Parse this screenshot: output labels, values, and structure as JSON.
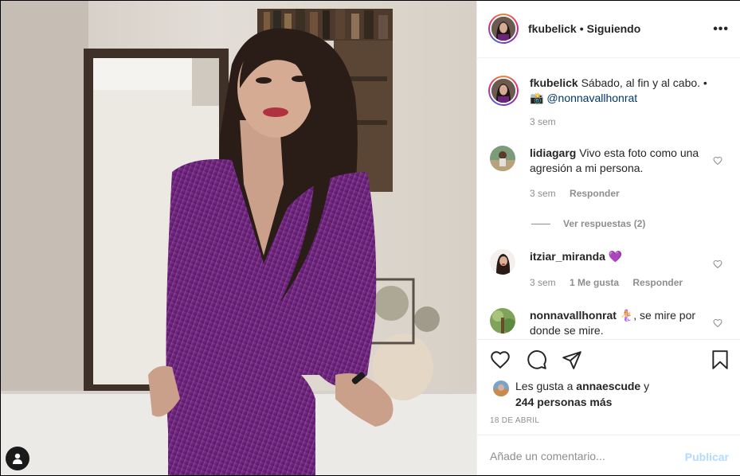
{
  "post": {
    "username": "fkubelick",
    "follow_status": "Siguiendo",
    "separator": "•",
    "more_icon": "more-horizontal-icon",
    "user_tag_icon": "person-tag-icon"
  },
  "caption": {
    "username": "fkubelick",
    "text": "Sábado, al fin y al cabo. •",
    "emoji": "📸",
    "mention": "@nonnavallhonrat",
    "time": "3 sem"
  },
  "comments": [
    {
      "username": "lidiagarg",
      "text": "Vivo esta foto como una agresión a mi persona.",
      "time": "3 sem",
      "reply_label": "Responder",
      "view_replies": "Ver respuestas (2)"
    },
    {
      "username": "itziar_miranda",
      "text": "💜",
      "time": "3 sem",
      "likes_label": "1 Me gusta",
      "reply_label": "Responder"
    },
    {
      "username": "nonnavallhonrat",
      "text": "🧜‍♀️, se mire por donde se mire."
    }
  ],
  "actions": {
    "like_icon": "heart-icon",
    "comment_icon": "comment-icon",
    "share_icon": "paper-plane-icon",
    "save_icon": "bookmark-icon"
  },
  "likes": {
    "prefix": "Les gusta a",
    "user": "annaescude",
    "conj": "y",
    "others": "244 personas más"
  },
  "date": "18 DE ABRIL",
  "add_comment": {
    "placeholder": "Añade un comentario...",
    "publish_label": "Publicar"
  },
  "colors": {
    "accent": "#0095f6",
    "publish_disabled": "#b3dbff",
    "dress": "#6b2a7a",
    "border": "#efefef"
  }
}
